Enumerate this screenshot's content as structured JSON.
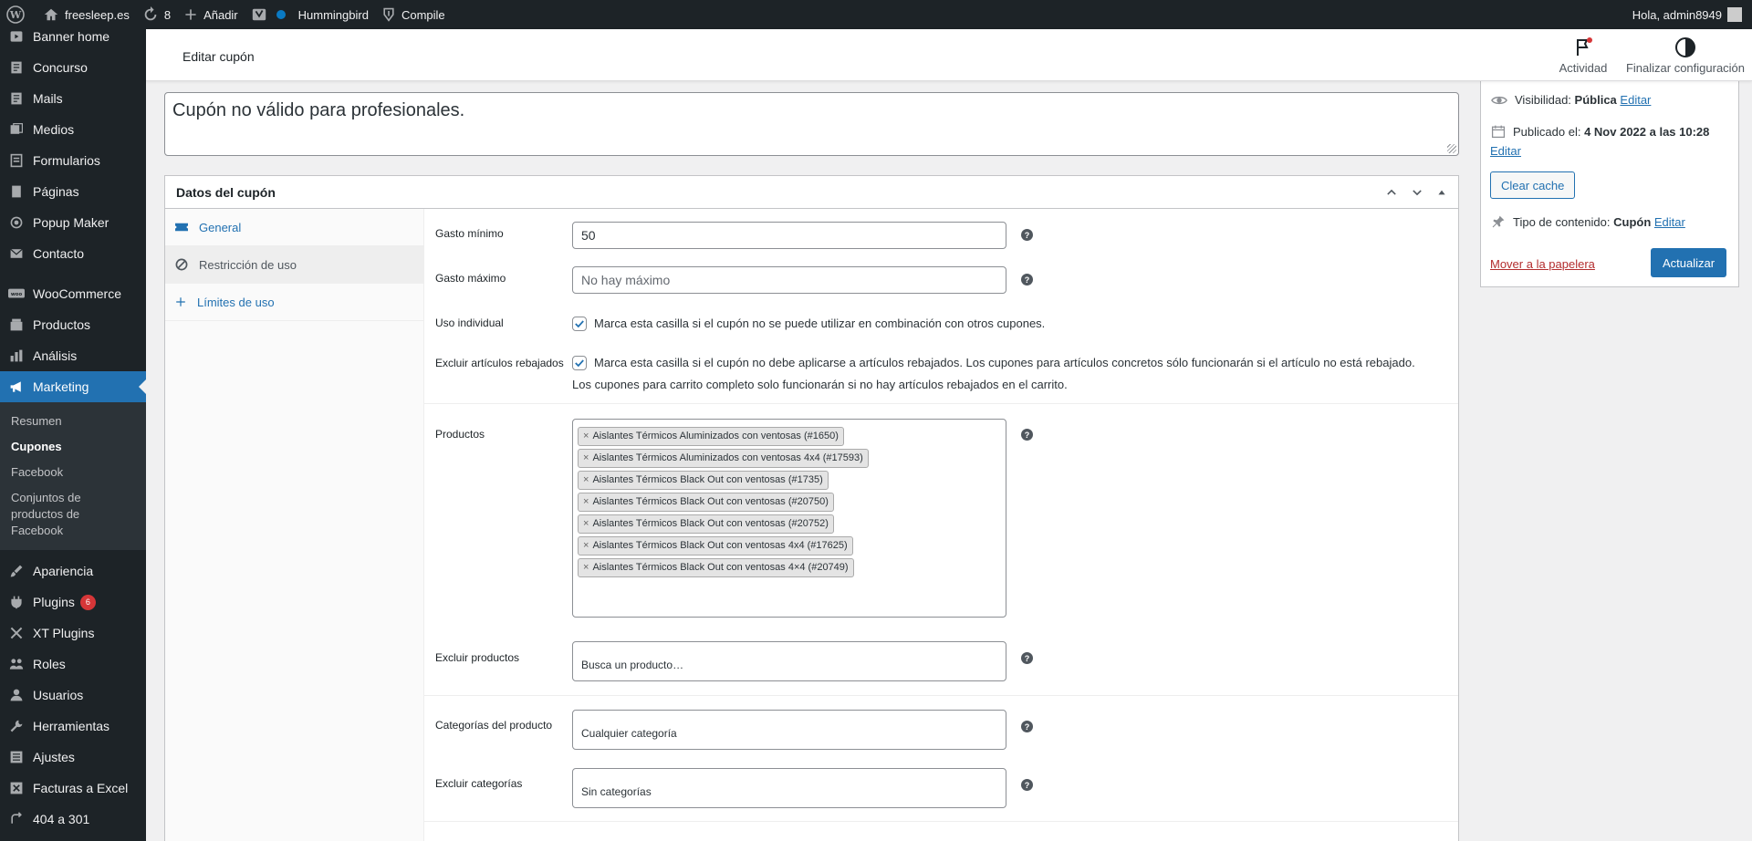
{
  "adminbar": {
    "site_name": "freesleep.es",
    "updates_count": "8",
    "add_label": "Añadir",
    "hummingbird_label": "Hummingbird",
    "compile_label": "Compile",
    "greeting": "Hola, admin8949"
  },
  "sidebar": {
    "top_items": [
      {
        "label": "Banner home",
        "icon": "video-icon"
      },
      {
        "label": "Concurso",
        "icon": "page-icon"
      },
      {
        "label": "Mails",
        "icon": "page-icon"
      },
      {
        "label": "Medios",
        "icon": "media-icon"
      },
      {
        "label": "Formularios",
        "icon": "forms-icon"
      },
      {
        "label": "Páginas",
        "icon": "pages-icon"
      },
      {
        "label": "Popup Maker",
        "icon": "popup-icon"
      },
      {
        "label": "Contacto",
        "icon": "mail-icon"
      }
    ],
    "commerce_items": [
      {
        "label": "WooCommerce",
        "icon": "woo-icon"
      },
      {
        "label": "Productos",
        "icon": "products-icon"
      },
      {
        "label": "Análisis",
        "icon": "chart-icon"
      },
      {
        "label": "Marketing",
        "icon": "megaphone-icon"
      }
    ],
    "submenu": [
      "Resumen",
      "Cupones",
      "Facebook",
      "Conjuntos de productos de Facebook"
    ],
    "bottom_items": [
      {
        "label": "Apariencia",
        "icon": "brush-icon"
      },
      {
        "label": "Plugins",
        "icon": "plugin-icon",
        "badge": "6"
      },
      {
        "label": "XT Plugins",
        "icon": "xt-icon"
      },
      {
        "label": "Roles",
        "icon": "roles-icon"
      },
      {
        "label": "Usuarios",
        "icon": "user-icon"
      },
      {
        "label": "Herramientas",
        "icon": "wrench-icon"
      },
      {
        "label": "Ajustes",
        "icon": "settings-icon"
      },
      {
        "label": "Facturas a Excel",
        "icon": "excel-icon"
      },
      {
        "label": "404 a 301",
        "icon": "redirect-icon"
      }
    ]
  },
  "header": {
    "title": "Editar cupón",
    "activity_label": "Actividad",
    "finish_setup_label": "Finalizar configuración"
  },
  "excerpt": {
    "text": "Cupón no válido para profesionales."
  },
  "coupon_data": {
    "title": "Datos del cupón",
    "tabs": [
      "General",
      "Restricción de uso",
      "Límites de uso"
    ],
    "min_spend": {
      "label": "Gasto mínimo",
      "value": "50"
    },
    "max_spend": {
      "label": "Gasto máximo",
      "placeholder": "No hay máximo"
    },
    "individual_use": {
      "label": "Uso individual",
      "text": "Marca esta casilla si el cupón no se puede utilizar en combinación con otros cupones.",
      "checked": true
    },
    "exclude_sale": {
      "label": "Excluir artículos rebajados",
      "text": "Marca esta casilla si el cupón no debe aplicarse a artículos rebajados. Los cupones para artículos concretos sólo funcionarán si el artículo no está rebajado. Los cupones para carrito completo solo funcionarán si no hay artículos rebajados en el carrito.",
      "checked": true
    },
    "products": {
      "label": "Productos",
      "tags": [
        "Aislantes Térmicos Aluminizados con ventosas (#1650)",
        "Aislantes Térmicos Aluminizados con ventosas 4x4 (#17593)",
        "Aislantes Térmicos Black Out con ventosas (#1735)",
        "Aislantes Térmicos Black Out con ventosas (#20750)",
        "Aislantes Térmicos Black Out con ventosas (#20752)",
        "Aislantes Térmicos Black Out con ventosas 4x4 (#17625)",
        "Aislantes Térmicos Black Out con ventosas 4×4 (#20749)"
      ]
    },
    "exclude_products": {
      "label": "Excluir productos",
      "placeholder": "Busca un producto…"
    },
    "categories": {
      "label": "Categorías del producto",
      "placeholder": "Cualquier categoría"
    },
    "exclude_categories": {
      "label": "Excluir categorías",
      "placeholder": "Sin categorías"
    }
  },
  "publish": {
    "visibility_label": "Visibilidad:",
    "visibility_value": "Pública",
    "edit_label": "Editar",
    "published_label": "Publicado el:",
    "published_value": "4 Nov 2022 a las 10:28",
    "clear_cache_label": "Clear cache",
    "content_type_label": "Tipo de contenido:",
    "content_type_value": "Cupón",
    "trash_label": "Mover a la papelera",
    "update_label": "Actualizar"
  }
}
